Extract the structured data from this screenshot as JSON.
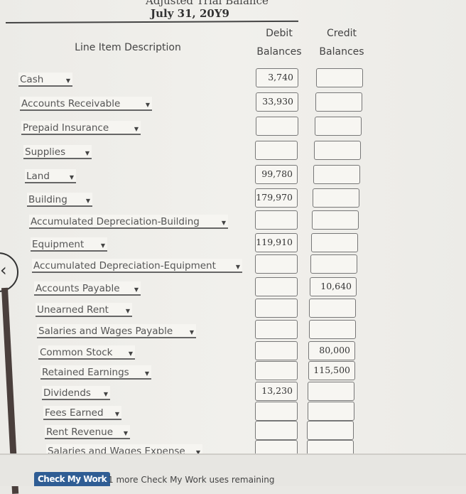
{
  "header": {
    "title_partial": "Adjusted Trial Balance",
    "date": "July 31, 20Y9",
    "col_description": "Line Item Description",
    "col_debit_1": "Debit",
    "col_debit_2": "Balances",
    "col_credit_1": "Credit",
    "col_credit_2": "Balances"
  },
  "rows": [
    {
      "account": "Cash",
      "debit": "3,740",
      "credit": ""
    },
    {
      "account": "Accounts Receivable",
      "debit": "33,930",
      "credit": ""
    },
    {
      "account": "Prepaid Insurance",
      "debit": "",
      "credit": ""
    },
    {
      "account": "Supplies",
      "debit": "",
      "credit": ""
    },
    {
      "account": "Land",
      "debit": "99,780",
      "credit": ""
    },
    {
      "account": "Building",
      "debit": "179,970",
      "credit": ""
    },
    {
      "account": "Accumulated Depreciation-Building",
      "debit": "",
      "credit": ""
    },
    {
      "account": "Equipment",
      "debit": "119,910",
      "credit": ""
    },
    {
      "account": "Accumulated Depreciation-Equipment",
      "debit": "",
      "credit": ""
    },
    {
      "account": "Accounts Payable",
      "debit": "",
      "credit": "10,640"
    },
    {
      "account": "Unearned Rent",
      "debit": "",
      "credit": ""
    },
    {
      "account": "Salaries and Wages Payable",
      "debit": "",
      "credit": ""
    },
    {
      "account": "Common Stock",
      "debit": "",
      "credit": "80,000"
    },
    {
      "account": "Retained Earnings",
      "debit": "",
      "credit": "115,500"
    },
    {
      "account": "Dividends",
      "debit": "13,230",
      "credit": ""
    },
    {
      "account": "Fees Earned",
      "debit": "",
      "credit": ""
    },
    {
      "account": "Rent Revenue",
      "debit": "",
      "credit": ""
    },
    {
      "account": "Salaries and Wages Expense",
      "debit": "",
      "credit": ""
    }
  ],
  "footer": {
    "check_button": "Check My Work",
    "remaining_text": "1 more Check My Work uses remaining"
  },
  "icons": {
    "dropdown": "chevron-down-icon",
    "back": "chevron-left-icon"
  },
  "colors": {
    "button_bg": "#2f5d94"
  }
}
